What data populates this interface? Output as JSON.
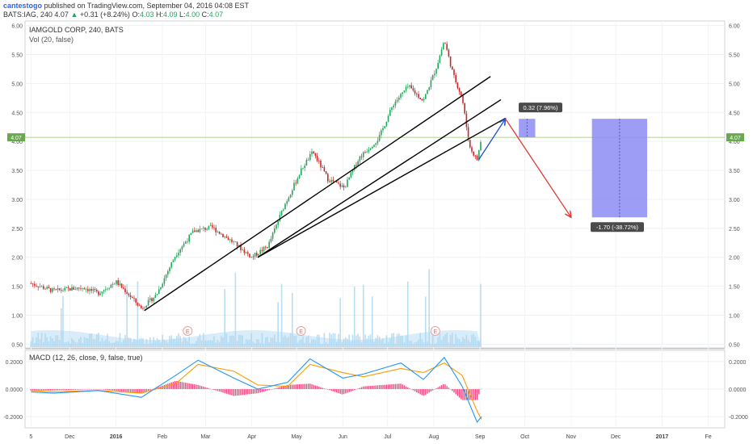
{
  "header": {
    "author": "cantestogo",
    "published": "published on TradingView.com, September 04, 2016 04:08 EST",
    "symbol": "BATS:IAG, 240",
    "last": "4.07",
    "change_arrow": "▲",
    "change": "+0.31 (+8.24%)",
    "o_label": "O:",
    "o_val": "4.03",
    "h_label": "H:",
    "h_val": "4.09",
    "l_label": "L:",
    "l_val": "4.00",
    "c_label": "C:",
    "c_val": "4.07"
  },
  "pane_main": {
    "title": "IAMGOLD CORP, 240, BATS",
    "volume_label": "Vol (20, false)"
  },
  "pane_macd": {
    "title": "MACD (12, 26, close, 9, false, true)"
  },
  "colors": {
    "up": "#26a65b",
    "down": "#c62828",
    "macd_line": "#2196f3",
    "signal_line": "#ff9800",
    "histogram": "#e91e63",
    "volume": "#90c8e8",
    "projection_box": "#8c8cf5",
    "trend_line": "#000000",
    "price_line": "#9bc26a"
  },
  "chart_data": [
    {
      "type": "candlestick",
      "symbol": "BATS:IAG",
      "interval": "240",
      "y_axis_ticks": [
        "0.50",
        "1.00",
        "1.50",
        "2.00",
        "2.50",
        "3.00",
        "3.50",
        "4.00",
        "4.50",
        "5.00",
        "5.50",
        "6.00"
      ],
      "ylim": [
        0.45,
        6.05
      ],
      "x_tick_labels": [
        "5",
        "Dec",
        "2016",
        "Feb",
        "Mar",
        "Apr",
        "May",
        "Jun",
        "Jul",
        "Aug",
        "Sep",
        "Oct",
        "Nov",
        "Dec",
        "2017",
        "Fe"
      ],
      "price_path": [
        {
          "date": "2015-11-05",
          "close": 1.55
        },
        {
          "date": "2015-11-20",
          "close": 1.42
        },
        {
          "date": "2015-12-10",
          "close": 1.48
        },
        {
          "date": "2015-12-20",
          "close": 1.38
        },
        {
          "date": "2016-01-01",
          "close": 1.58
        },
        {
          "date": "2016-01-08",
          "close": 1.4
        },
        {
          "date": "2016-01-18",
          "close": 1.12
        },
        {
          "date": "2016-01-28",
          "close": 1.35
        },
        {
          "date": "2016-02-10",
          "close": 2.05
        },
        {
          "date": "2016-02-22",
          "close": 2.45
        },
        {
          "date": "2016-03-05",
          "close": 2.52
        },
        {
          "date": "2016-03-20",
          "close": 2.25
        },
        {
          "date": "2016-04-01",
          "close": 2.0
        },
        {
          "date": "2016-04-12",
          "close": 2.2
        },
        {
          "date": "2016-04-22",
          "close": 2.85
        },
        {
          "date": "2016-05-05",
          "close": 3.55
        },
        {
          "date": "2016-05-12",
          "close": 3.82
        },
        {
          "date": "2016-05-22",
          "close": 3.35
        },
        {
          "date": "2016-06-02",
          "close": 3.2
        },
        {
          "date": "2016-06-12",
          "close": 3.72
        },
        {
          "date": "2016-06-25",
          "close": 4.05
        },
        {
          "date": "2016-07-05",
          "close": 4.65
        },
        {
          "date": "2016-07-15",
          "close": 4.95
        },
        {
          "date": "2016-07-25",
          "close": 4.7
        },
        {
          "date": "2016-08-03",
          "close": 5.3
        },
        {
          "date": "2016-08-08",
          "close": 5.75
        },
        {
          "date": "2016-08-14",
          "close": 5.15
        },
        {
          "date": "2016-08-20",
          "close": 4.75
        },
        {
          "date": "2016-08-25",
          "close": 3.9
        },
        {
          "date": "2016-08-30",
          "close": 3.68
        },
        {
          "date": "2016-09-02",
          "close": 4.07
        }
      ],
      "current_price": 4.07,
      "annotations": [
        {
          "kind": "trend_line",
          "from": {
            "date": "2016-01-20",
            "price": 1.08
          },
          "to": {
            "date": "2016-09-08",
            "price": 5.12
          }
        },
        {
          "kind": "trend_line",
          "from": {
            "date": "2016-04-05",
            "price": 2.0
          },
          "to": {
            "date": "2016-09-15",
            "price": 4.72
          }
        },
        {
          "kind": "trend_line",
          "from": {
            "date": "2016-04-05",
            "price": 2.0
          },
          "to": {
            "date": "2016-09-18",
            "price": 4.4
          }
        },
        {
          "kind": "arrow",
          "color": "blue",
          "from": {
            "date": "2016-08-31",
            "price": 3.68
          },
          "to": {
            "date": "2016-09-18",
            "price": 4.39
          }
        },
        {
          "kind": "arrow",
          "color": "red",
          "from": {
            "date": "2016-09-18",
            "price": 4.39
          },
          "to": {
            "date": "2016-11-01",
            "price": 2.69
          }
        },
        {
          "kind": "measure",
          "label": "0.32 (7.96%)",
          "from_price": 4.07,
          "to_price": 4.39
        },
        {
          "kind": "measure",
          "label": "-1.70 (-38.72%)",
          "from_price": 4.39,
          "to_price": 2.69
        }
      ]
    },
    {
      "type": "bar",
      "name": "Vol (20, false)",
      "note": "volume histogram with moving average area",
      "earnings_markers": [
        {
          "date": "2016-02-18",
          "label": "E"
        },
        {
          "date": "2016-05-04",
          "label": "E"
        },
        {
          "date": "2016-08-02",
          "label": "E"
        }
      ]
    },
    {
      "type": "line",
      "name": "MACD (12, 26, close, 9, false, true)",
      "y_axis_ticks": [
        "-0.2000",
        "0.0000",
        "0.2000"
      ],
      "ylim": [
        -0.27,
        0.27
      ],
      "series": [
        {
          "name": "MACD",
          "points": [
            {
              "date": "2015-11-05",
              "value": -0.02
            },
            {
              "date": "2015-11-20",
              "value": -0.03
            },
            {
              "date": "2015-12-20",
              "value": -0.01
            },
            {
              "date": "2016-01-18",
              "value": -0.06
            },
            {
              "date": "2016-02-10",
              "value": 0.1
            },
            {
              "date": "2016-02-25",
              "value": 0.21
            },
            {
              "date": "2016-03-20",
              "value": 0.08
            },
            {
              "date": "2016-04-05",
              "value": 0.0
            },
            {
              "date": "2016-04-25",
              "value": 0.05
            },
            {
              "date": "2016-05-10",
              "value": 0.22
            },
            {
              "date": "2016-06-01",
              "value": 0.08
            },
            {
              "date": "2016-06-15",
              "value": 0.11
            },
            {
              "date": "2016-07-10",
              "value": 0.19
            },
            {
              "date": "2016-07-25",
              "value": 0.07
            },
            {
              "date": "2016-08-08",
              "value": 0.23
            },
            {
              "date": "2016-08-20",
              "value": 0.02
            },
            {
              "date": "2016-08-30",
              "value": -0.24
            },
            {
              "date": "2016-09-02",
              "value": -0.2
            }
          ]
        },
        {
          "name": "Signal",
          "points": [
            {
              "date": "2015-11-05",
              "value": -0.01
            },
            {
              "date": "2015-11-20",
              "value": -0.02
            },
            {
              "date": "2015-12-20",
              "value": -0.01
            },
            {
              "date": "2016-01-18",
              "value": -0.03
            },
            {
              "date": "2016-02-10",
              "value": 0.04
            },
            {
              "date": "2016-02-25",
              "value": 0.18
            },
            {
              "date": "2016-03-20",
              "value": 0.13
            },
            {
              "date": "2016-04-05",
              "value": 0.03
            },
            {
              "date": "2016-04-25",
              "value": 0.02
            },
            {
              "date": "2016-05-10",
              "value": 0.18
            },
            {
              "date": "2016-06-01",
              "value": 0.12
            },
            {
              "date": "2016-06-15",
              "value": 0.09
            },
            {
              "date": "2016-07-10",
              "value": 0.15
            },
            {
              "date": "2016-07-25",
              "value": 0.12
            },
            {
              "date": "2016-08-08",
              "value": 0.19
            },
            {
              "date": "2016-08-20",
              "value": 0.1
            },
            {
              "date": "2016-08-30",
              "value": -0.16
            },
            {
              "date": "2016-09-02",
              "value": -0.22
            }
          ]
        }
      ]
    }
  ]
}
